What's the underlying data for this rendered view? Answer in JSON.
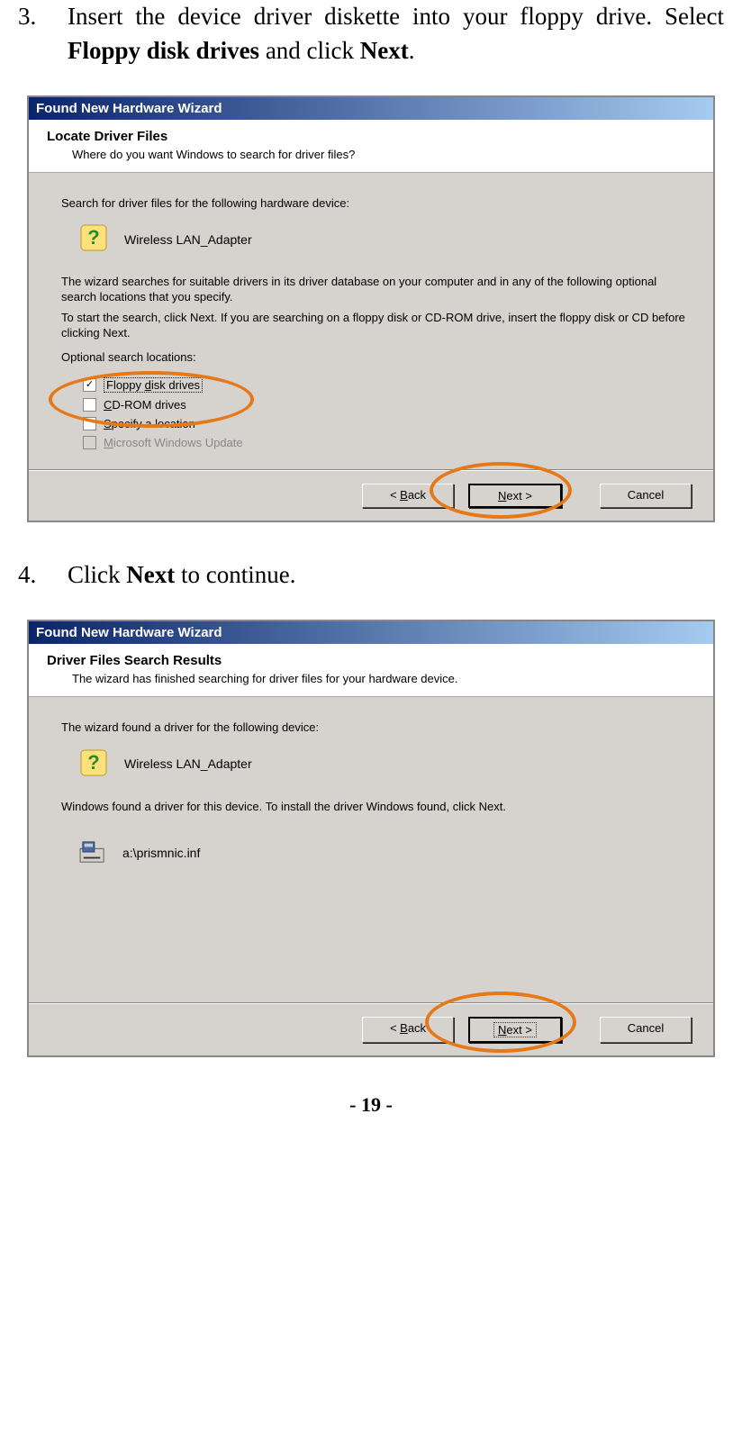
{
  "step3": {
    "num": "3.",
    "text_a": "Insert the device driver diskette into your floppy drive.   Select ",
    "bold_a": "Floppy disk drives",
    "text_b": " and click ",
    "bold_b": "Next",
    "text_c": "."
  },
  "dialog1": {
    "title": "Found New Hardware Wizard",
    "heading": "Locate Driver Files",
    "sub": "Where do you want Windows to search for driver files?",
    "p1": "Search for driver files for the following hardware device:",
    "device": "Wireless LAN_Adapter",
    "p2": "The wizard searches for suitable drivers in its driver database on your computer and in any of the following optional search locations that you specify.",
    "p3": "To start the search, click Next. If you are searching on a floppy disk or CD-ROM drive, insert the floppy disk or CD before clicking Next.",
    "opt_label": "Optional search locations:",
    "opt1": "Floppy disk drives",
    "opt2": "CD-ROM drives",
    "opt3": "Specify a location",
    "opt4": "Microsoft Windows Update",
    "back": "< Back",
    "next": "Next >",
    "cancel": "Cancel"
  },
  "step4": {
    "num": "4.",
    "text_a": "Click ",
    "bold_a": "Next",
    "text_b": " to continue."
  },
  "dialog2": {
    "title": "Found New Hardware Wizard",
    "heading": "Driver Files Search Results",
    "sub": "The wizard has finished searching for driver files for your hardware device.",
    "p1": "The wizard found a driver for the following device:",
    "device": "Wireless LAN_Adapter",
    "p2": "Windows found a driver for this device. To install the driver Windows found, click Next.",
    "path": "a:\\prismnic.inf",
    "back": "< Back",
    "next": "Next >",
    "cancel": "Cancel"
  },
  "page_number": "- 19 -"
}
